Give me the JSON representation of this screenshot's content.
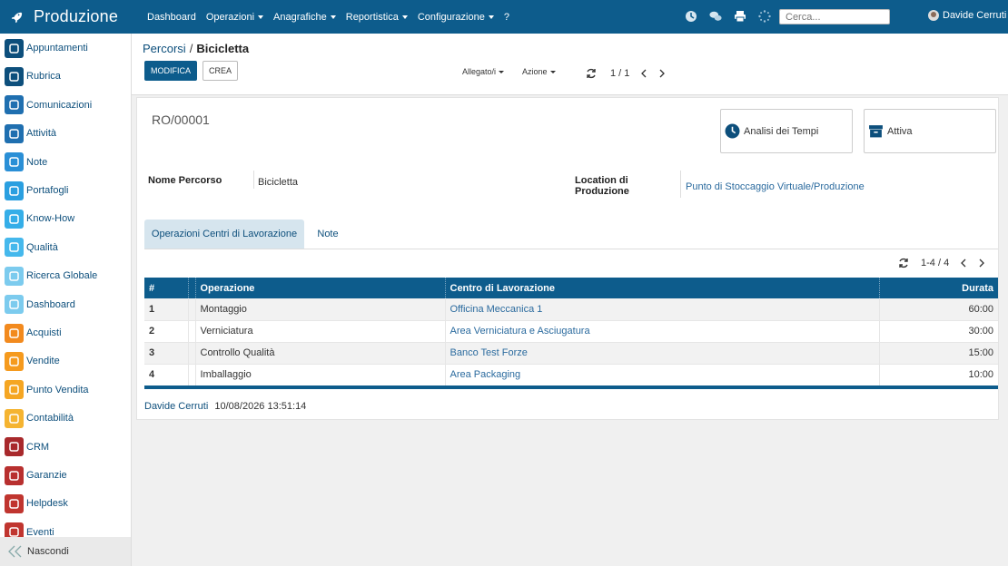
{
  "app": {
    "title": "Produzione"
  },
  "nav": {
    "items": [
      {
        "label": "Dashboard",
        "caret": false
      },
      {
        "label": "Operazioni",
        "caret": true
      },
      {
        "label": "Anagrafiche",
        "caret": true
      },
      {
        "label": "Reportistica",
        "caret": true
      },
      {
        "label": "Configurazione",
        "caret": true
      },
      {
        "label": "?",
        "caret": false
      }
    ],
    "search_placeholder": "Cerca...",
    "user": "Davide Cerruti",
    "icons": [
      "clock-icon",
      "chat-icon",
      "print-icon",
      "spinner-icon"
    ]
  },
  "sidebar": {
    "items": [
      {
        "label": "Appuntamenti",
        "color": "#0d4f7c",
        "icon": "calendar-icon"
      },
      {
        "label": "Rubrica",
        "color": "#0d4f7c",
        "icon": "contacts-icon"
      },
      {
        "label": "Comunicazioni",
        "color": "#1f6fb0",
        "icon": "message-icon"
      },
      {
        "label": "Attività",
        "color": "#1f6fb0",
        "icon": "check-icon"
      },
      {
        "label": "Note",
        "color": "#2a8fd6",
        "icon": "note-icon"
      },
      {
        "label": "Portafogli",
        "color": "#2a9fe0",
        "icon": "lock-icon"
      },
      {
        "label": "Know-How",
        "color": "#35aee8",
        "icon": "brain-icon"
      },
      {
        "label": "Qualità",
        "color": "#45b8ec",
        "icon": "gauge-icon"
      },
      {
        "label": "Ricerca Globale",
        "color": "#7ccbee",
        "icon": "search-icon"
      },
      {
        "label": "Dashboard",
        "color": "#7ccbee",
        "icon": "dashboard-icon"
      },
      {
        "label": "Acquisti",
        "color": "#f28a1e",
        "icon": "purchase-icon"
      },
      {
        "label": "Vendite",
        "color": "#f59a1e",
        "icon": "chart-icon"
      },
      {
        "label": "Punto Vendita",
        "color": "#f5a623",
        "icon": "pos-icon"
      },
      {
        "label": "Contabilità",
        "color": "#f5b431",
        "icon": "ledger-icon"
      },
      {
        "label": "CRM",
        "color": "#a8292c",
        "icon": "handshake-icon"
      },
      {
        "label": "Garanzie",
        "color": "#b8302f",
        "icon": "shield-icon"
      },
      {
        "label": "Helpdesk",
        "color": "#c0352f",
        "icon": "headset-icon"
      },
      {
        "label": "Eventi",
        "color": "#c0352f",
        "icon": "ticket-icon"
      }
    ],
    "collapse_label": "Nascondi"
  },
  "header": {
    "breadcrumb_parent": "Percorsi",
    "breadcrumb_sep": "/",
    "breadcrumb_current": "Bicicletta",
    "edit_label": "MODIFICA",
    "create_label": "CREA",
    "attachments_label": "Allegato/i",
    "action_label": "Azione",
    "pager": "1 / 1"
  },
  "record": {
    "reference": "RO/00001",
    "smart_buttons": [
      {
        "label": "Analisi dei Tempi",
        "icon": "clock-icon"
      },
      {
        "label": "Attiva",
        "icon": "archive-icon"
      }
    ],
    "route_name_label": "Nome Percorso",
    "route_name_value": "Bicicletta",
    "location_label_1": "Location di",
    "location_label_2": "Produzione",
    "location_value": "Punto di Stoccaggio Virtuale/Produzione"
  },
  "tabs": [
    {
      "label": "Operazioni Centri di Lavorazione",
      "active": true
    },
    {
      "label": "Note",
      "active": false
    }
  ],
  "operations": {
    "pager": "1-4 / 4",
    "columns": [
      "#",
      "",
      "Operazione",
      "Centro di Lavorazione",
      "Durata"
    ],
    "rows": [
      {
        "seq": "1",
        "operation": "Montaggio",
        "workcenter": "Officina Meccanica 1",
        "duration": "60:00"
      },
      {
        "seq": "2",
        "operation": "Verniciatura",
        "workcenter": "Area Verniciatura e Asciugatura",
        "duration": "30:00"
      },
      {
        "seq": "3",
        "operation": "Controllo Qualità",
        "workcenter": "Banco Test Forze",
        "duration": "15:00"
      },
      {
        "seq": "4",
        "operation": "Imballaggio",
        "workcenter": "Area Packaging",
        "duration": "10:00"
      }
    ]
  },
  "footer": {
    "author": "Davide Cerruti",
    "timestamp": "10/08/2026 13:51:14"
  }
}
